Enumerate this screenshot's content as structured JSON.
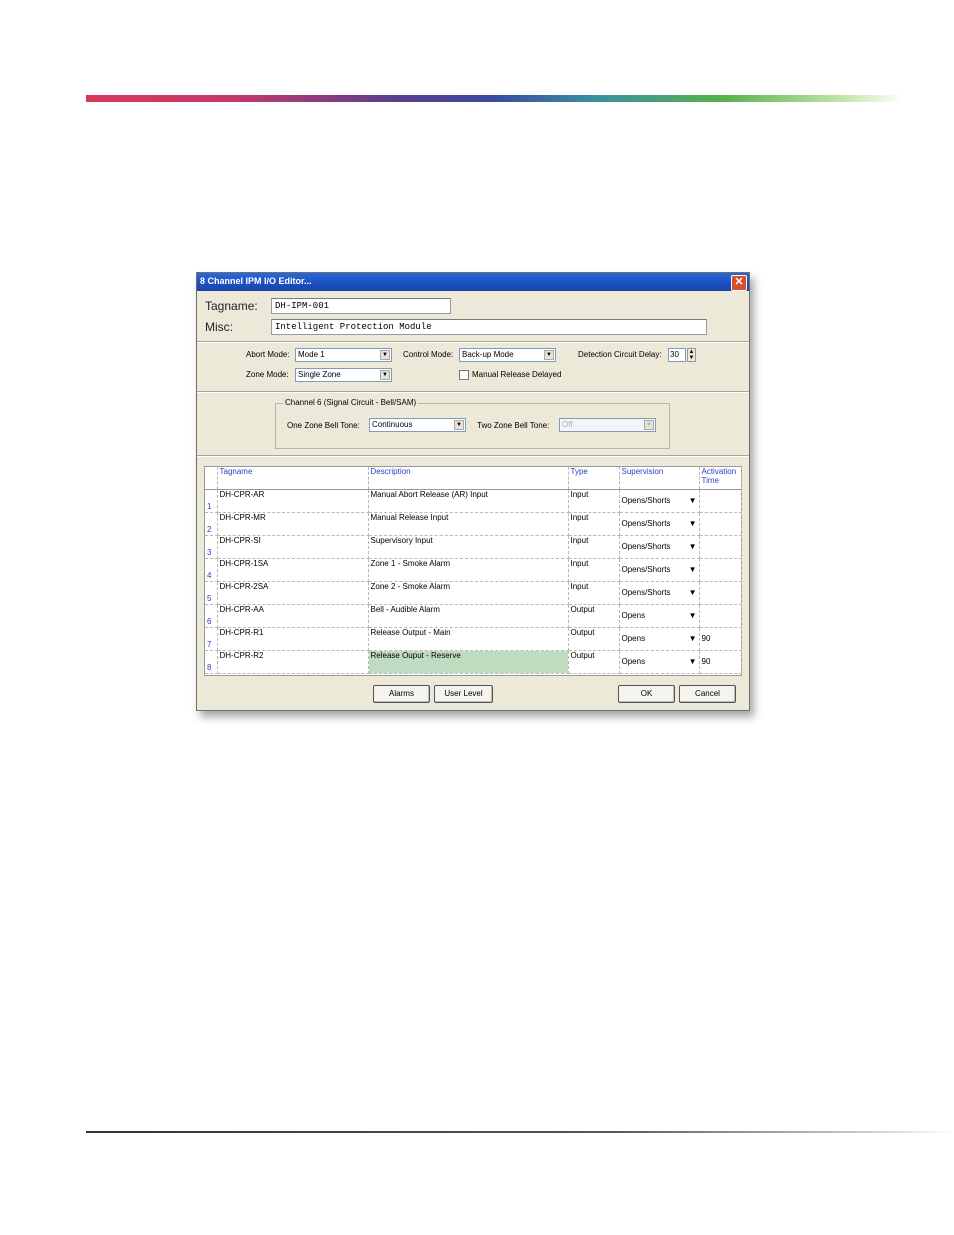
{
  "window": {
    "title": "8 Channel IPM I/O Editor...",
    "close": "✕"
  },
  "tagname": {
    "label": "Tagname:",
    "value": "DH-IPM-001"
  },
  "misc": {
    "label": "Misc:",
    "value": "Intelligent Protection Module"
  },
  "abort_mode": {
    "label": "Abort Mode:",
    "value": "Mode 1"
  },
  "control_mode": {
    "label": "Control Mode:",
    "value": "Back-up Mode"
  },
  "detection_delay": {
    "label": "Detection Circuit Delay:",
    "value": "30"
  },
  "zone_mode": {
    "label": "Zone Mode:",
    "value": "Single Zone"
  },
  "manual_release_delayed": {
    "label": "Manual Release Delayed",
    "checked": false
  },
  "channel6": {
    "legend": "Channel 6 (Signal Circuit - Bell/SAM)",
    "one_zone_label": "One Zone Bell Tone:",
    "one_zone_value": "Continuous",
    "two_zone_label": "Two Zone Bell Tone:",
    "two_zone_value": "Off"
  },
  "table": {
    "headers": [
      "Tagname",
      "Description",
      "Type",
      "Supervision",
      "Activation Time"
    ],
    "rows": [
      {
        "n": "1",
        "tag": "DH-CPR-AR",
        "desc": "Manual Abort Release (AR) Input",
        "type": "Input",
        "sup": "Opens/Shorts",
        "act": ""
      },
      {
        "n": "2",
        "tag": "DH-CPR-MR",
        "desc": "Manual Release Input",
        "type": "Input",
        "sup": "Opens/Shorts",
        "act": ""
      },
      {
        "n": "3",
        "tag": "DH-CPR-SI",
        "desc": "Supervisory Input",
        "type": "Input",
        "sup": "Opens/Shorts",
        "act": ""
      },
      {
        "n": "4",
        "tag": "DH-CPR-1SA",
        "desc": "Zone 1 - Smoke Alarm",
        "type": "Input",
        "sup": "Opens/Shorts",
        "act": ""
      },
      {
        "n": "5",
        "tag": "DH-CPR-2SA",
        "desc": "Zone 2 - Smoke Alarm",
        "type": "Input",
        "sup": "Opens/Shorts",
        "act": ""
      },
      {
        "n": "6",
        "tag": "DH-CPR-AA",
        "desc": "Bell - Audible Alarm",
        "type": "Output",
        "sup": "Opens",
        "act": ""
      },
      {
        "n": "7",
        "tag": "DH-CPR-R1",
        "desc": "Release Output - Main",
        "type": "Output",
        "sup": "Opens",
        "act": "90"
      },
      {
        "n": "8",
        "tag": "DH-CPR-R2",
        "desc": "Release Ouput - Reserve",
        "type": "Output",
        "sup": "Opens",
        "act": "90"
      }
    ]
  },
  "buttons": {
    "alarms": "Alarms",
    "user_level": "User Level",
    "ok": "OK",
    "cancel": "Cancel"
  }
}
